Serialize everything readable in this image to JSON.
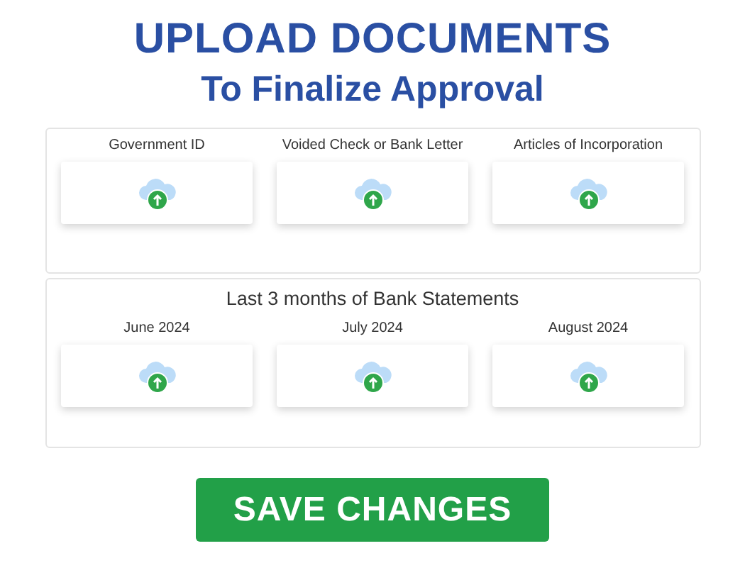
{
  "title": "UPLOAD DOCUMENTS",
  "subtitle": "To Finalize Approval",
  "sections": [
    {
      "slots": [
        {
          "label": "Government ID"
        },
        {
          "label": "Voided Check or Bank Letter"
        },
        {
          "label": "Articles of Incorporation"
        }
      ]
    },
    {
      "heading": "Last 3 months of Bank Statements",
      "slots": [
        {
          "label": "June 2024"
        },
        {
          "label": "July 2024"
        },
        {
          "label": "August 2024"
        }
      ]
    }
  ],
  "button": "SAVE CHANGES"
}
